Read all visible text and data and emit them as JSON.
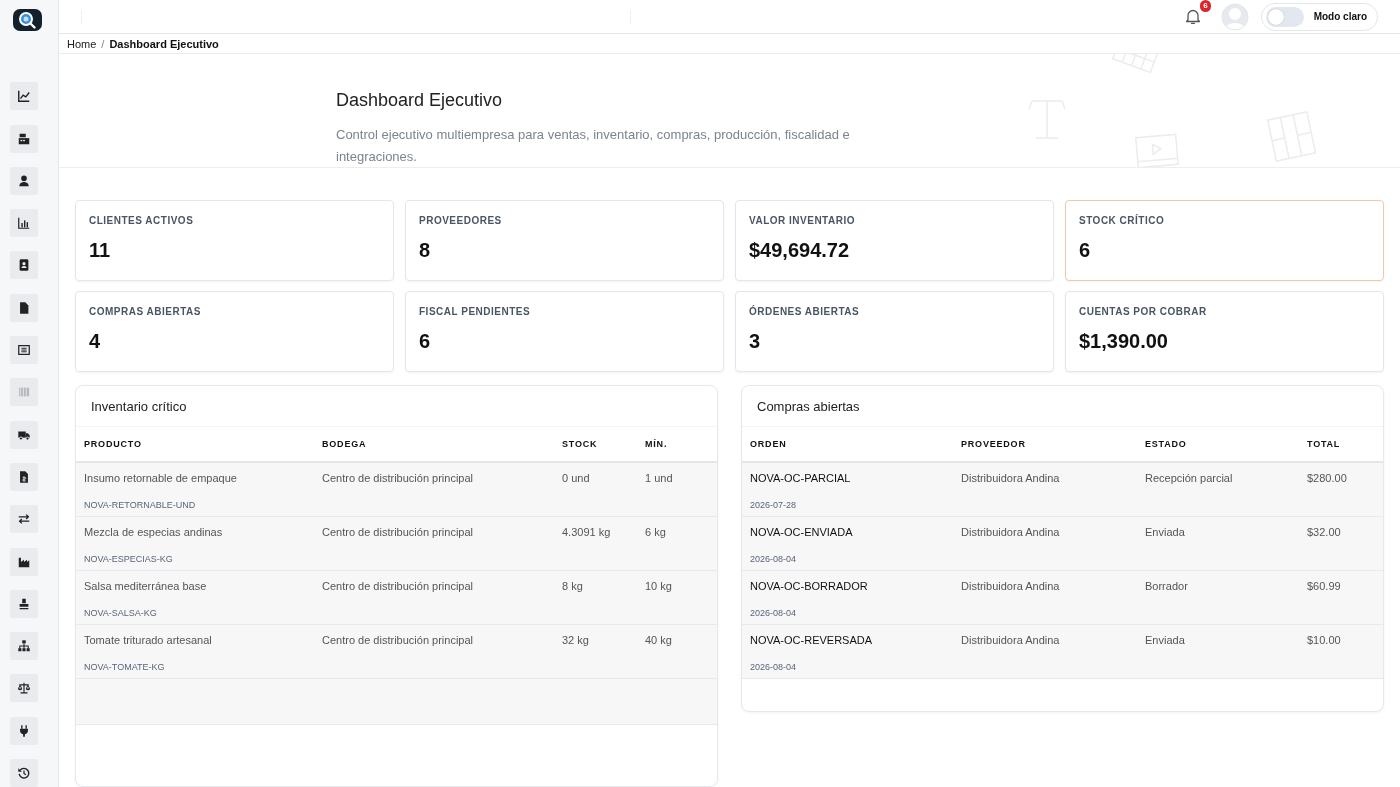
{
  "sidebar": {
    "items": [
      {
        "kind": "chart-line",
        "disabled": false
      },
      {
        "kind": "register",
        "disabled": false
      },
      {
        "kind": "user",
        "disabled": false
      },
      {
        "kind": "chart-bar",
        "disabled": false
      },
      {
        "kind": "contact",
        "disabled": false
      },
      {
        "kind": "file",
        "disabled": false
      },
      {
        "kind": "list",
        "disabled": false
      },
      {
        "kind": "barcode",
        "disabled": true
      },
      {
        "kind": "truck",
        "disabled": false
      },
      {
        "kind": "invoice",
        "disabled": false
      },
      {
        "kind": "swap",
        "disabled": false
      },
      {
        "kind": "factory",
        "disabled": false
      },
      {
        "kind": "stamp",
        "disabled": false
      },
      {
        "kind": "sitemap",
        "disabled": false
      },
      {
        "kind": "scale",
        "disabled": false
      },
      {
        "kind": "plug",
        "disabled": false
      },
      {
        "kind": "history",
        "disabled": false
      }
    ]
  },
  "topbar": {
    "notification_count": "6",
    "theme_toggle": {
      "label": "Modo claro",
      "on": false
    }
  },
  "breadcrumb": {
    "separator": "/",
    "items": [
      {
        "label": "Home",
        "current": false
      },
      {
        "label": "Dashboard Ejecutivo",
        "current": true
      }
    ]
  },
  "hero": {
    "title": "Dashboard Ejecutivo",
    "subtitle": "Control ejecutivo multiempresa para ventas, inventario, compras, producción, fiscalidad e integraciones."
  },
  "stats": [
    {
      "label": "CLIENTES ACTIVOS",
      "value": "11",
      "alert": false
    },
    {
      "label": "PROVEEDORES",
      "value": "8",
      "alert": false
    },
    {
      "label": "VALOR INVENTARIO",
      "value": "$49,694.72",
      "alert": false
    },
    {
      "label": "STOCK CRÍTICO",
      "value": "6",
      "alert": true
    },
    {
      "label": "COMPRAS ABIERTAS",
      "value": "4",
      "alert": false
    },
    {
      "label": "FISCAL PENDIENTES",
      "value": "6",
      "alert": false
    },
    {
      "label": "ÓRDENES ABIERTAS",
      "value": "3",
      "alert": false
    },
    {
      "label": "CUENTAS POR COBRAR",
      "value": "$1,390.00",
      "alert": false
    }
  ],
  "tables": [
    {
      "title": "Inventario crítico",
      "columns": [
        "PRODUCTO",
        "BODEGA",
        "STOCK",
        "MÍN."
      ],
      "rows": [
        {
          "cells": [
            "Insumo retornable de empaque",
            "Centro de distribución principal",
            "0 und",
            "1 und"
          ],
          "sub": "NOVA-RETORNABLE-UND"
        },
        {
          "cells": [
            "Mezcla de especias andinas",
            "Centro de distribución principal",
            "4.3091 kg",
            "6 kg"
          ],
          "sub": "NOVA-ESPECIAS-KG"
        },
        {
          "cells": [
            "Salsa mediterránea base",
            "Centro de distribución principal",
            "8 kg",
            "10 kg"
          ],
          "sub": "NOVA-SALSA-KG"
        },
        {
          "cells": [
            "Tomate triturado artesanal",
            "Centro de distribución principal",
            "32 kg",
            "40 kg"
          ],
          "sub": "NOVA-TOMATE-KG"
        }
      ]
    },
    {
      "title": "Compras abiertas",
      "columns": [
        "ORDEN",
        "PROVEEDOR",
        "ESTADO",
        "TOTAL"
      ],
      "rows": [
        {
          "cells": [
            "NOVA-OC-PARCIAL",
            "Distribuidora Andina",
            "Recepción parcial",
            "$280.00"
          ],
          "sub": "2026-07-28"
        },
        {
          "cells": [
            "NOVA-OC-ENVIADA",
            "Distribuidora Andina",
            "Enviada",
            "$32.00"
          ],
          "sub": "2026-08-04"
        },
        {
          "cells": [
            "NOVA-OC-BORRADOR",
            "Distribuidora Andina",
            "Borrador",
            "$60.99"
          ],
          "sub": "2026-08-04"
        },
        {
          "cells": [
            "NOVA-OC-REVERSADA",
            "Distribuidora Andina",
            "Enviada",
            "$10.00"
          ],
          "sub": "2026-08-04"
        }
      ]
    }
  ]
}
